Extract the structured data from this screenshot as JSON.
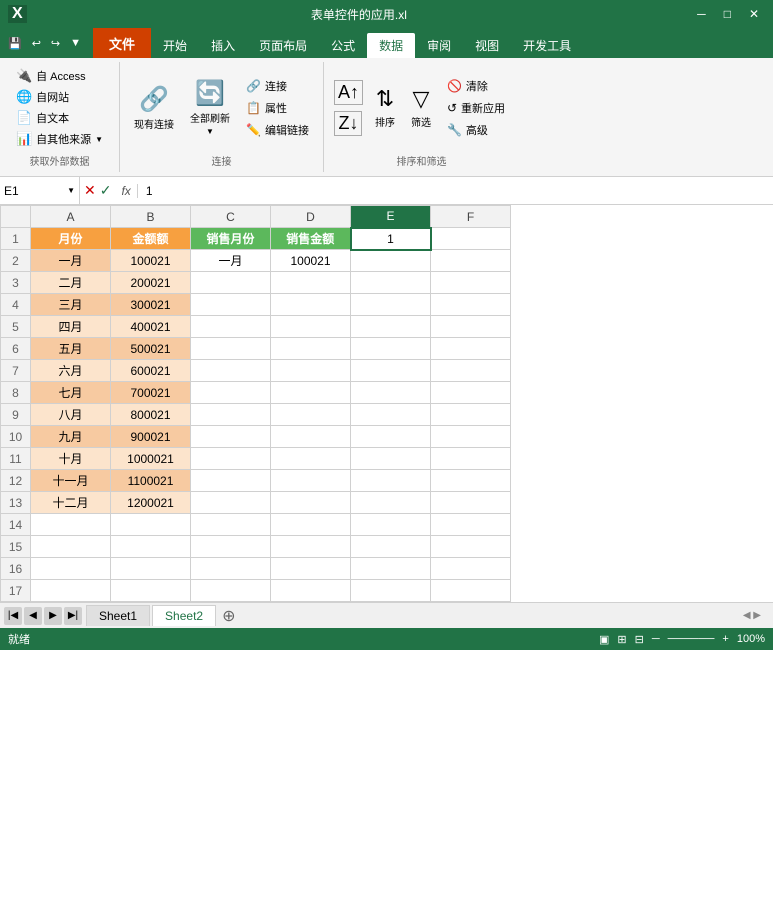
{
  "titleBar": {
    "title": "表单控件的应用.xl",
    "appName": "Excel"
  },
  "quickAccess": {
    "save": "💾",
    "undo": "↩",
    "redo": "↪"
  },
  "ribbonTabs": [
    "文件",
    "开始",
    "插入",
    "页面布局",
    "公式",
    "数据",
    "审阅",
    "视图",
    "开发工具"
  ],
  "activeTab": "数据",
  "groups": {
    "getExternalData": {
      "label": "获取外部数据",
      "buttons": [
        {
          "icon": "🔌",
          "label": "自 Access"
        },
        {
          "icon": "🌐",
          "label": "自网站"
        },
        {
          "icon": "📄",
          "label": "自文本"
        },
        {
          "icon": "📊",
          "label": "自其他来源"
        }
      ]
    },
    "connections": {
      "label": "连接",
      "buttons": [
        {
          "icon": "🔗",
          "label": "现有连接"
        },
        {
          "icon": "🔄",
          "label": "全部刷新"
        },
        {
          "icon": "🔗",
          "small": "连接"
        },
        {
          "icon": "📋",
          "small": "属性"
        },
        {
          "icon": "✏️",
          "small": "编辑链接"
        }
      ]
    },
    "sortFilter": {
      "label": "排序和筛选",
      "buttons": [
        {
          "icon": "AZ↑",
          "label": ""
        },
        {
          "icon": "ZA↓",
          "label": ""
        },
        {
          "icon": "🔽",
          "label": "排序"
        },
        {
          "icon": "▼",
          "label": "筛选"
        },
        {
          "icon": "🚫",
          "small": "清除"
        },
        {
          "icon": "↺",
          "small": "重新应用"
        },
        {
          "icon": "🔧",
          "small": "高级"
        }
      ]
    }
  },
  "formulaBar": {
    "nameBox": "E1",
    "formula": "1"
  },
  "columns": [
    "A",
    "B",
    "C",
    "D",
    "E",
    "F"
  ],
  "columnHeaders": {
    "A": "月份",
    "B": "金额额",
    "C": "销售月份",
    "D": "销售金额",
    "E": "1",
    "F": ""
  },
  "rows": [
    {
      "row": 1,
      "A": "月份",
      "B": "金额额",
      "C": "销售月份",
      "D": "销售金额",
      "E": "1",
      "F": "",
      "styleA": "header-orange",
      "styleB": "header-orange",
      "styleC": "header-green",
      "styleD": "header-green",
      "isHeader": true
    },
    {
      "row": 2,
      "A": "一月",
      "B": "100021",
      "C": "一月",
      "D": "100021",
      "E": "",
      "F": "",
      "styleA": "orange-bg",
      "styleB": "light-orange-bg"
    },
    {
      "row": 3,
      "A": "二月",
      "B": "200021",
      "C": "",
      "D": "",
      "E": "",
      "F": "",
      "styleA": "light-orange-bg",
      "styleB": "light-orange-bg"
    },
    {
      "row": 4,
      "A": "三月",
      "B": "300021",
      "C": "",
      "D": "",
      "E": "",
      "F": "",
      "styleA": "orange-bg",
      "styleB": "orange-bg"
    },
    {
      "row": 5,
      "A": "四月",
      "B": "400021",
      "C": "",
      "D": "",
      "E": "",
      "F": "",
      "styleA": "light-orange-bg",
      "styleB": "light-orange-bg"
    },
    {
      "row": 6,
      "A": "五月",
      "B": "500021",
      "C": "",
      "D": "",
      "E": "",
      "F": "",
      "styleA": "orange-bg",
      "styleB": "orange-bg"
    },
    {
      "row": 7,
      "A": "六月",
      "B": "600021",
      "C": "",
      "D": "",
      "E": "",
      "F": "",
      "styleA": "light-orange-bg",
      "styleB": "light-orange-bg"
    },
    {
      "row": 8,
      "A": "七月",
      "B": "700021",
      "C": "",
      "D": "",
      "E": "",
      "F": "",
      "styleA": "orange-bg",
      "styleB": "orange-bg"
    },
    {
      "row": 9,
      "A": "八月",
      "B": "800021",
      "C": "",
      "D": "",
      "E": "",
      "F": "",
      "styleA": "light-orange-bg",
      "styleB": "light-orange-bg"
    },
    {
      "row": 10,
      "A": "九月",
      "B": "900021",
      "C": "",
      "D": "",
      "E": "",
      "F": "",
      "styleA": "orange-bg",
      "styleB": "orange-bg"
    },
    {
      "row": 11,
      "A": "十月",
      "B": "1000021",
      "C": "",
      "D": "",
      "E": "",
      "F": "",
      "styleA": "light-orange-bg",
      "styleB": "light-orange-bg"
    },
    {
      "row": 12,
      "A": "十一月",
      "B": "1100021",
      "C": "",
      "D": "",
      "E": "",
      "F": "",
      "styleA": "orange-bg",
      "styleB": "orange-bg"
    },
    {
      "row": 13,
      "A": "十二月",
      "B": "1200021",
      "C": "",
      "D": "",
      "E": "",
      "F": "",
      "styleA": "light-orange-bg",
      "styleB": "light-orange-bg"
    },
    {
      "row": 14,
      "A": "",
      "B": "",
      "C": "",
      "D": "",
      "E": "",
      "F": ""
    },
    {
      "row": 15,
      "A": "",
      "B": "",
      "C": "",
      "D": "",
      "E": "",
      "F": ""
    },
    {
      "row": 16,
      "A": "",
      "B": "",
      "C": "",
      "D": "",
      "E": "",
      "F": ""
    },
    {
      "row": 17,
      "A": "",
      "B": "",
      "C": "",
      "D": "",
      "E": "",
      "F": ""
    }
  ],
  "sheetTabs": [
    "Sheet1",
    "Sheet2"
  ],
  "activeSheet": "Sheet2",
  "statusBar": {
    "left": "就绪",
    "zoom": "100%"
  }
}
